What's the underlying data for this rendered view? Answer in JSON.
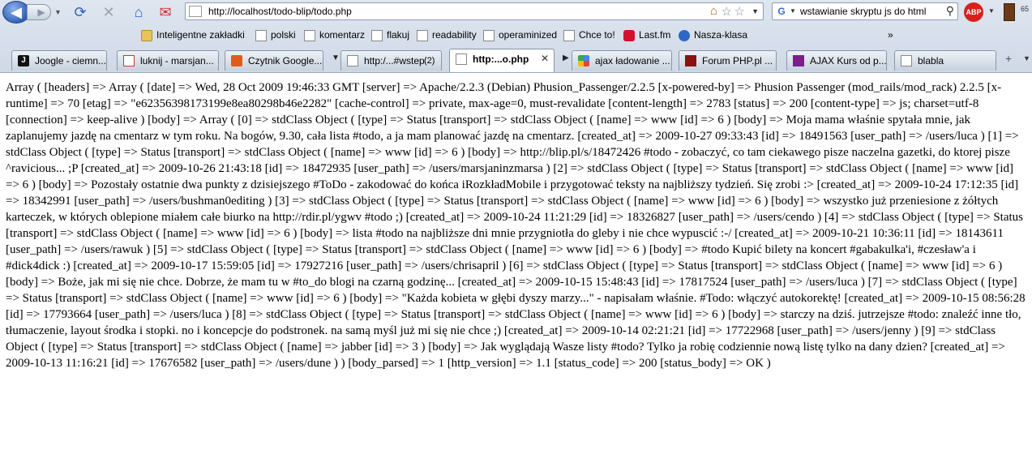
{
  "navigation": {
    "back_glyph": "◀",
    "forward_glyph": "▶",
    "url": "http://localhost/todo-blip/todo.php",
    "search_query": "wstawianie skryptu js do html",
    "search_engine_glyph": "G",
    "abp_label": "ABP",
    "right_number": "65"
  },
  "bookmarks": [
    {
      "label": "Inteligentne zakładki",
      "icon": "folder-icon"
    },
    {
      "label": "polski",
      "icon": "page-icon"
    },
    {
      "label": "komentarz",
      "icon": "page-icon"
    },
    {
      "label": "flakuj",
      "icon": "page-icon"
    },
    {
      "label": "readability",
      "icon": "page-icon"
    },
    {
      "label": "operaminized",
      "icon": "page-icon"
    },
    {
      "label": "Chce to!",
      "icon": "page-icon"
    },
    {
      "label": "Last.fm",
      "icon": "lastfm-icon"
    },
    {
      "label": "Nasza-klasa",
      "icon": "nasza-klasa-icon"
    }
  ],
  "bookmarks_more": "»",
  "tabs": [
    {
      "label": "Joogle - ciemn...",
      "icon_text": "J"
    },
    {
      "label": "luknij - marsjan...",
      "icon_text": "M"
    },
    {
      "label": "Czytnik Google...",
      "icon_text": ""
    },
    {
      "label": "http:/...#wstep",
      "icon_text": "",
      "count": "(2)"
    },
    {
      "label": "http:...o.php",
      "icon_text": "",
      "close": "✕"
    },
    {
      "label": "ajax ładowanie ...",
      "icon_text": ""
    },
    {
      "label": "Forum PHP.pl ...",
      "icon_text": ""
    },
    {
      "label": "AJAX Kurs od p...",
      "icon_text": ""
    },
    {
      "label": "blabla",
      "icon_text": ""
    }
  ],
  "tab_plus": "+",
  "page_text": "Array ( [headers] => Array ( [date] => Wed, 28 Oct 2009 19:46:33 GMT [server] => Apache/2.2.3 (Debian) Phusion_Passenger/2.2.5 [x-powered-by] => Phusion Passenger (mod_rails/mod_rack) 2.2.5 [x-runtime] => 70 [etag] => \"e62356398173199e8ea80298b46e2282\" [cache-control] => private, max-age=0, must-revalidate [content-length] => 2783 [status] => 200 [content-type] => js; charset=utf-8 [connection] => keep-alive ) [body] => Array ( [0] => stdClass Object ( [type] => Status [transport] => stdClass Object ( [name] => www [id] => 6 ) [body] => Moja mama właśnie spytała mnie, jak zaplanujemy jazdę na cmentarz w tym roku. Na bogów, 9.30, cała lista #todo, a ja mam planować jazdę na cmentarz. [created_at] => 2009-10-27 09:33:43 [id] => 18491563 [user_path] => /users/luca ) [1] => stdClass Object ( [type] => Status [transport] => stdClass Object ( [name] => www [id] => 6 ) [body] => http://blip.pl/s/18472426 #todo - zobaczyć, co tam ciekawego pisze naczelna gazetki, do ktorej pisze ^ravicious... ;P [created_at] => 2009-10-26 21:43:18 [id] => 18472935 [user_path] => /users/marsjaninzmarsa ) [2] => stdClass Object ( [type] => Status [transport] => stdClass Object ( [name] => www [id] => 6 ) [body] => Pozostały ostatnie dwa punkty z dzisiejszego #ToDo - zakodować do końca iRozkładMobile i przygotować teksty na najbliższy tydzień. Się zrobi :> [created_at] => 2009-10-24 17:12:35 [id] => 18342991 [user_path] => /users/bushman0editing ) [3] => stdClass Object ( [type] => Status [transport] => stdClass Object ( [name] => www [id] => 6 ) [body] => wszystko już przeniesione z żółtych karteczek, w których oblepione miałem całe biurko na http://rdir.pl/ygwv #todo ;) [created_at] => 2009-10-24 11:21:29 [id] => 18326827 [user_path] => /users/cendo ) [4] => stdClass Object ( [type] => Status [transport] => stdClass Object ( [name] => www [id] => 6 ) [body] => lista #todo na najbliższe dni mnie przygniotła do gleby i nie chce wypuscić :-/ [created_at] => 2009-10-21 10:36:11 [id] => 18143611 [user_path] => /users/rawuk ) [5] => stdClass Object ( [type] => Status [transport] => stdClass Object ( [name] => www [id] => 6 ) [body] => #todo Kupić bilety na koncert #gabakulka'i, #czesław'a i #dick4dick :) [created_at] => 2009-10-17 15:59:05 [id] => 17927216 [user_path] => /users/chrisapril ) [6] => stdClass Object ( [type] => Status [transport] => stdClass Object ( [name] => www [id] => 6 ) [body] => Boże, jak mi się nie chce. Dobrze, że mam tu w #to_do blogi na czarną godzinę... [created_at] => 2009-10-15 15:48:43 [id] => 17817524 [user_path] => /users/luca ) [7] => stdClass Object ( [type] => Status [transport] => stdClass Object ( [name] => www [id] => 6 ) [body] => \"Każda kobieta w głębi dyszy marzy...\" - napisałam właśnie. #Todo: włączyć autokorektę! [created_at] => 2009-10-15 08:56:28 [id] => 17793664 [user_path] => /users/luca ) [8] => stdClass Object ( [type] => Status [transport] => stdClass Object ( [name] => www [id] => 6 ) [body] => starczy na dziś. jutrzejsze #todo: znaleźć inne tło, tłumaczenie, layout środka i stopki. no i koncepcje do podstronek. na samą myśl już mi się nie chce ;) [created_at] => 2009-10-14 02:21:21 [id] => 17722968 [user_path] => /users/jenny ) [9] => stdClass Object ( [type] => Status [transport] => stdClass Object ( [name] => jabber [id] => 3 ) [body] => Jak wyglądają Wasze listy #todo? Tylko ja robię codziennie nową listę tylko na dany dzien? [created_at] => 2009-10-13 11:16:21 [id] => 17676582 [user_path] => /users/dune ) ) [body_parsed] => 1 [http_version] => 1.1 [status_code] => 200 [status_body] => OK )"
}
